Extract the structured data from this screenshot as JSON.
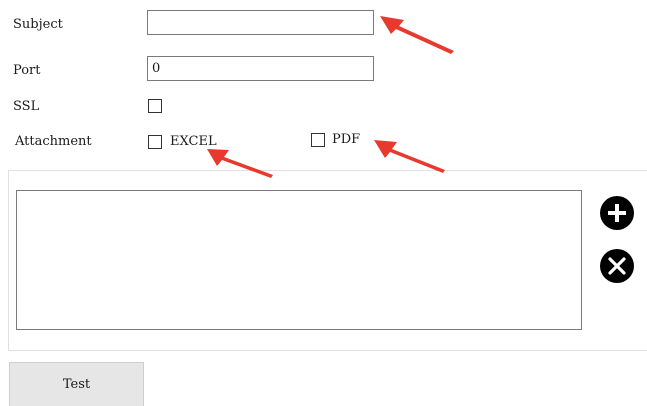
{
  "form": {
    "subject_label": "Subject",
    "subject_value": "",
    "port_label": "Port",
    "port_value": "0",
    "ssl_label": "SSL",
    "attachment_label": "Attachment",
    "excel_label": "EXCEL",
    "pdf_label": "PDF"
  },
  "actions": {
    "add_icon": "plus-circle-icon",
    "remove_icon": "close-circle-icon",
    "test_label": "Test"
  },
  "colors": {
    "arrow": "#e8392f",
    "button_bg": "#e6e6e6",
    "icon": "#000000"
  }
}
